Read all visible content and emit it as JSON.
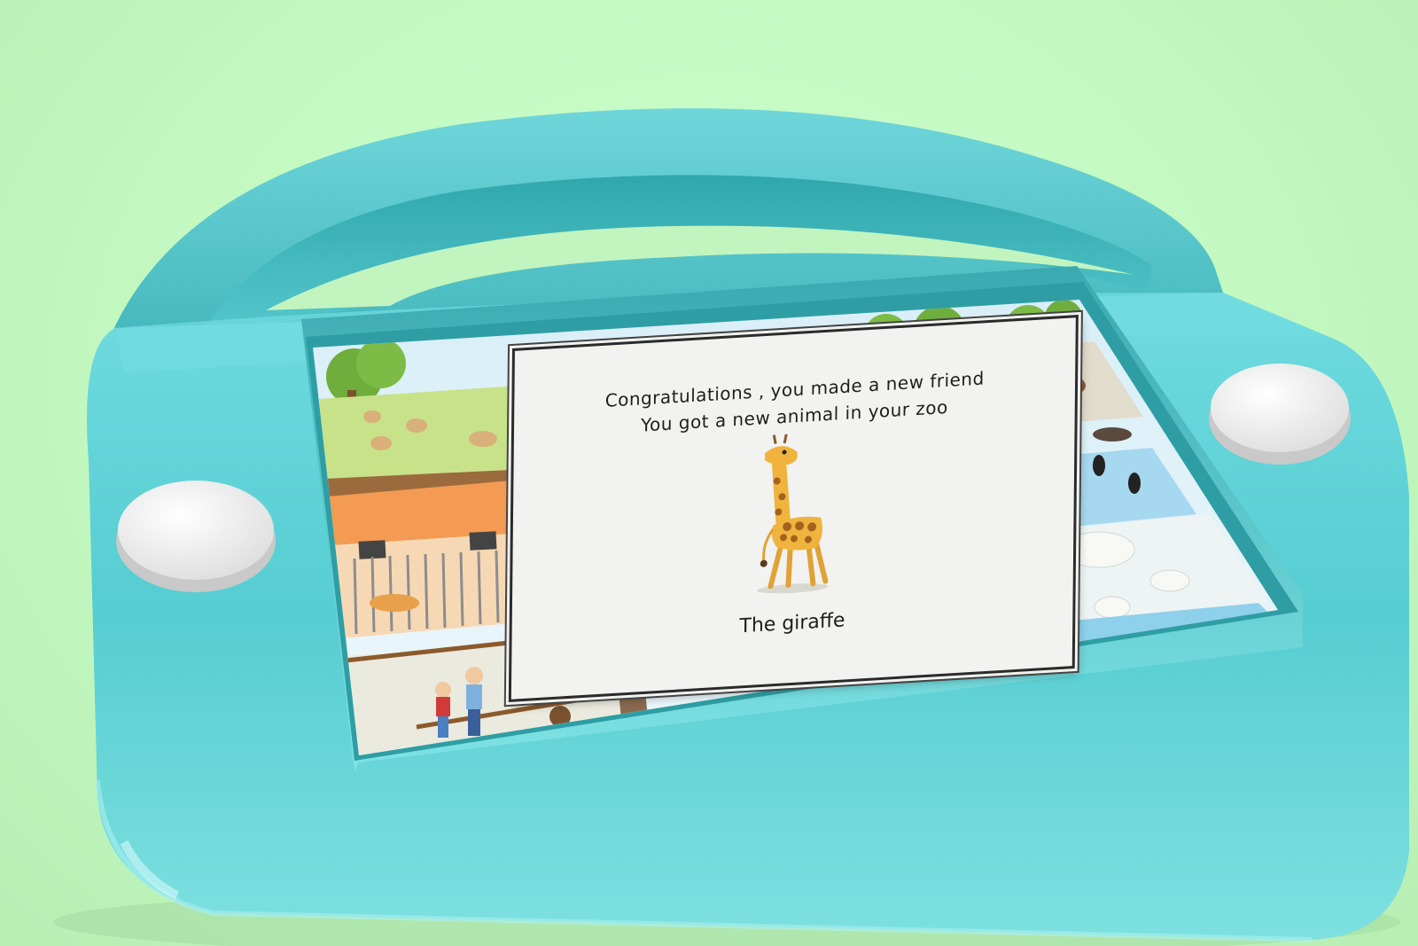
{
  "card": {
    "line1": "Congratulations , you made a new friend",
    "line2": "You got a new animal in your zoo",
    "animal_name": "The giraffe"
  },
  "colors": {
    "background": "#c6fbc4",
    "device_body": "#5cd0d2",
    "card_background": "#f2f2f0",
    "card_border": "#2b2b2b"
  },
  "icons": {
    "left_button": "round-button",
    "right_button": "round-button",
    "animal": "giraffe-icon"
  }
}
